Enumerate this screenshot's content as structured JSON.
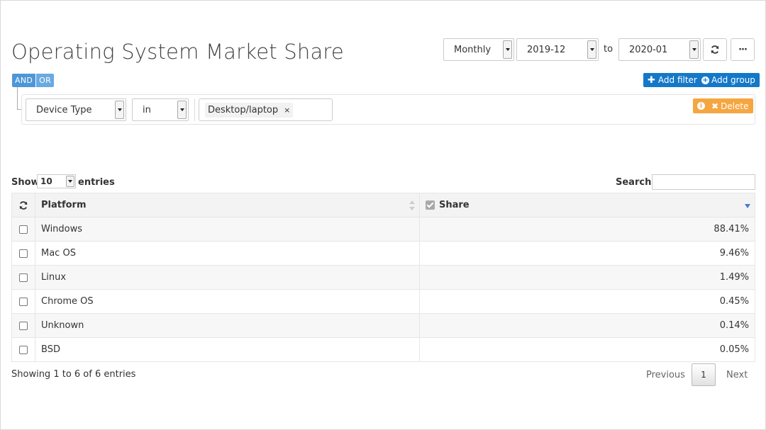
{
  "title": "Operating System Market Share",
  "toolbar": {
    "period": "Monthly",
    "from": "2019-12",
    "to_label": "to",
    "to": "2020-01",
    "refresh_icon": "refresh-icon",
    "more_label": "···"
  },
  "query": {
    "and_label": "AND",
    "or_label": "OR",
    "add_filter_label": "Add filter",
    "add_group_label": "Add group",
    "delete_label": "Delete",
    "rule": {
      "field": "Device Type",
      "operator": "in",
      "value_tag": "Desktop/laptop",
      "tag_remove": "×"
    }
  },
  "table_controls": {
    "show_label": "Show",
    "length": "10",
    "entries_label": "entries",
    "search_label": "Search:"
  },
  "table": {
    "columns": [
      "Platform",
      "Share"
    ],
    "rows": [
      {
        "platform": "Windows",
        "share": "88.41%"
      },
      {
        "platform": "Mac OS",
        "share": "9.46%"
      },
      {
        "platform": "Linux",
        "share": "1.49%"
      },
      {
        "platform": "Chrome OS",
        "share": "0.45%"
      },
      {
        "platform": "Unknown",
        "share": "0.14%"
      },
      {
        "platform": "BSD",
        "share": "0.05%"
      }
    ]
  },
  "footer": {
    "info": "Showing 1 to 6 of 6 entries",
    "previous": "Previous",
    "page": "1",
    "next": "Next"
  },
  "colors": {
    "primary_blue": "#1478c9",
    "andor_blue": "#4d97d8",
    "delete_orange": "#f5a640",
    "sort_arrow": "#4a7bd0"
  }
}
